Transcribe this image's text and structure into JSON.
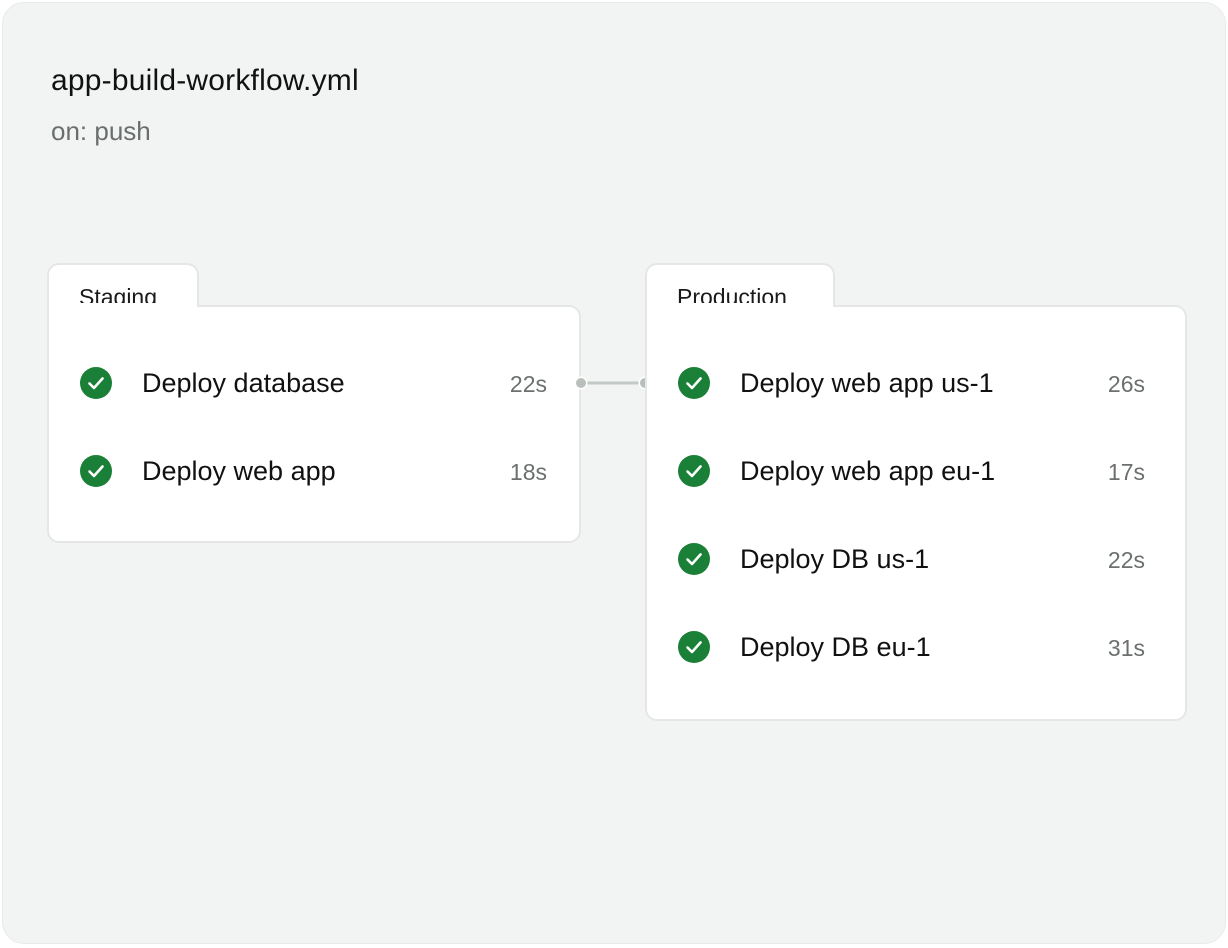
{
  "workflow": {
    "title": "app-build-workflow.yml",
    "trigger": "on: push"
  },
  "groups": [
    {
      "name": "Staging",
      "jobs": [
        {
          "name": "Deploy database",
          "duration": "22s",
          "status": "success"
        },
        {
          "name": "Deploy web app",
          "duration": "18s",
          "status": "success"
        }
      ]
    },
    {
      "name": "Production",
      "jobs": [
        {
          "name": "Deploy web app us-1",
          "duration": "26s",
          "status": "success"
        },
        {
          "name": "Deploy web app eu-1",
          "duration": "17s",
          "status": "success"
        },
        {
          "name": "Deploy DB us-1",
          "duration": "22s",
          "status": "success"
        },
        {
          "name": "Deploy DB eu-1",
          "duration": "31s",
          "status": "success"
        }
      ]
    }
  ],
  "icons": {
    "success": "check-circle-icon"
  },
  "colors": {
    "success": "#1a7f37",
    "background": "#f2f4f3",
    "card": "#ffffff",
    "connector": "#b9c0bc"
  }
}
